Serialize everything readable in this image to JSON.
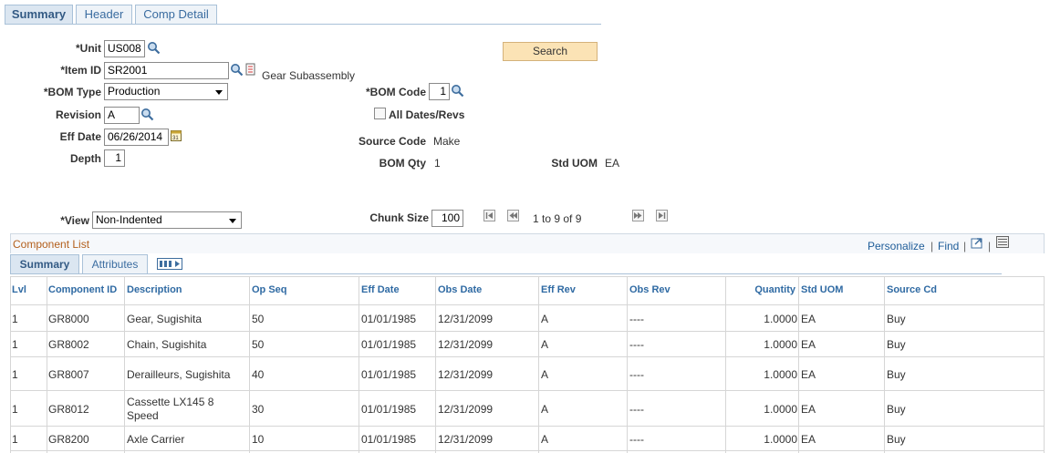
{
  "tabs": [
    "Summary",
    "Header",
    "Comp Detail"
  ],
  "form": {
    "unit_label": "*Unit",
    "unit_value": "US008",
    "item_label": "*Item ID",
    "item_value": "SR2001",
    "item_desc": "Gear Subassembly",
    "bomtype_label": "*BOM Type",
    "bomtype_value": "Production",
    "revision_label": "Revision",
    "revision_value": "A",
    "effdate_label": "Eff Date",
    "effdate_value": "06/26/2014",
    "depth_label": "Depth",
    "depth_value": "1",
    "search_label": "Search",
    "bomcode_label": "*BOM Code",
    "bomcode_value": "1",
    "alldates_label": "All Dates/Revs",
    "sourcecode_label": "Source Code",
    "sourcecode_value": "Make",
    "bomqty_label": "BOM Qty",
    "bomqty_value": "1",
    "stduom_label": "Std UOM",
    "stduom_value": "EA",
    "view_label": "*View",
    "view_value": "Non-Indented",
    "chunk_label": "Chunk Size",
    "chunk_value": "100",
    "range_text": "1 to 9 of 9"
  },
  "component_list": {
    "title": "Component List",
    "personalize": "Personalize",
    "find": "Find",
    "subtabs": [
      "Summary",
      "Attributes"
    ],
    "columns": [
      "Lvl",
      "Component ID",
      "Description",
      "Op Seq",
      "Eff Date",
      "Obs Date",
      "Eff Rev",
      "Obs Rev",
      "Quantity",
      "Std UOM",
      "Source Cd"
    ],
    "rows": [
      {
        "lvl": "1",
        "id": "GR8000",
        "desc": "Gear, Sugishita",
        "desc2": "",
        "opseq": "50",
        "eff": "01/01/1985",
        "obs": "12/31/2099",
        "effrev": "A",
        "obsrev": "----",
        "qty": "1.0000",
        "uom": "EA",
        "src": "Buy"
      },
      {
        "lvl": "1",
        "id": "GR8002",
        "desc": "Chain, Sugishita",
        "desc2": "",
        "opseq": "50",
        "eff": "01/01/1985",
        "obs": "12/31/2099",
        "effrev": "A",
        "obsrev": "----",
        "qty": "1.0000",
        "uom": "EA",
        "src": "Buy"
      },
      {
        "lvl": "1",
        "id": "GR8007",
        "desc": "Derailleurs, Sugishita",
        "desc2": "",
        "opseq": "40",
        "eff": "01/01/1985",
        "obs": "12/31/2099",
        "effrev": "A",
        "obsrev": "----",
        "qty": "1.0000",
        "uom": "EA",
        "src": "Buy"
      },
      {
        "lvl": "1",
        "id": "GR8012",
        "desc": "Cassette LX145 8",
        "desc2": "Speed",
        "opseq": "30",
        "eff": "01/01/1985",
        "obs": "12/31/2099",
        "effrev": "A",
        "obsrev": "----",
        "qty": "1.0000",
        "uom": "EA",
        "src": "Buy"
      },
      {
        "lvl": "1",
        "id": "GR8200",
        "desc": "Axle Carrier",
        "desc2": "",
        "opseq": "10",
        "eff": "01/01/1985",
        "obs": "12/31/2099",
        "effrev": "A",
        "obsrev": "----",
        "qty": "1.0000",
        "uom": "EA",
        "src": "Buy"
      }
    ]
  },
  "colors": {
    "accent_link": "#1f5d99",
    "search_btn": "#fbe3b5",
    "list_title": "#b35f1c"
  },
  "icons": [
    "magnifier-icon",
    "prompt-detail-icon",
    "calendar-icon",
    "first-page-icon",
    "prev-page-icon",
    "next-page-icon",
    "last-page-icon",
    "zoom-icon",
    "download-icon",
    "show-all-columns-icon"
  ]
}
